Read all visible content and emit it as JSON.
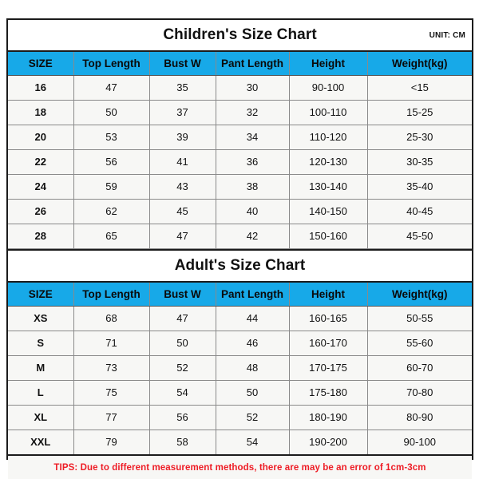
{
  "page": {
    "background_color": "#ffffff",
    "accent_color": "#17a9e8",
    "tips_color": "#ee1c25",
    "border_color": "#1b1b1b",
    "row_background": "#f7f7f5"
  },
  "children_chart": {
    "title": "Children's Size Chart",
    "unit_label": "UNIT: CM",
    "columns": [
      "SIZE",
      "Top Length",
      "Bust W",
      "Pant Length",
      "Height",
      "Weight(kg)"
    ],
    "rows": [
      [
        "16",
        "47",
        "35",
        "30",
        "90-100",
        "<15"
      ],
      [
        "18",
        "50",
        "37",
        "32",
        "100-110",
        "15-25"
      ],
      [
        "20",
        "53",
        "39",
        "34",
        "110-120",
        "25-30"
      ],
      [
        "22",
        "56",
        "41",
        "36",
        "120-130",
        "30-35"
      ],
      [
        "24",
        "59",
        "43",
        "38",
        "130-140",
        "35-40"
      ],
      [
        "26",
        "62",
        "45",
        "40",
        "140-150",
        "40-45"
      ],
      [
        "28",
        "65",
        "47",
        "42",
        "150-160",
        "45-50"
      ]
    ]
  },
  "adult_chart": {
    "title": "Adult's Size Chart",
    "columns": [
      "SIZE",
      "Top Length",
      "Bust W",
      "Pant Length",
      "Height",
      "Weight(kg)"
    ],
    "rows": [
      [
        "XS",
        "68",
        "47",
        "44",
        "160-165",
        "50-55"
      ],
      [
        "S",
        "71",
        "50",
        "46",
        "160-170",
        "55-60"
      ],
      [
        "M",
        "73",
        "52",
        "48",
        "170-175",
        "60-70"
      ],
      [
        "L",
        "75",
        "54",
        "50",
        "175-180",
        "70-80"
      ],
      [
        "XL",
        "77",
        "56",
        "52",
        "180-190",
        "80-90"
      ],
      [
        "XXL",
        "79",
        "58",
        "54",
        "190-200",
        "90-100"
      ]
    ]
  },
  "footer": {
    "tips": "TIPS: Due to different measurement methods, there are may be an error of 1cm-3cm"
  },
  "chart_data": {
    "type": "table",
    "title": "Children's and Adult's Size Charts",
    "unit": "CM",
    "tables": [
      {
        "name": "Children's Size Chart",
        "columns": [
          "SIZE",
          "Top Length",
          "Bust W",
          "Pant Length",
          "Height",
          "Weight(kg)"
        ],
        "rows": [
          [
            "16",
            "47",
            "35",
            "30",
            "90-100",
            "<15"
          ],
          [
            "18",
            "50",
            "37",
            "32",
            "100-110",
            "15-25"
          ],
          [
            "20",
            "53",
            "39",
            "34",
            "110-120",
            "25-30"
          ],
          [
            "22",
            "56",
            "41",
            "36",
            "120-130",
            "30-35"
          ],
          [
            "24",
            "59",
            "43",
            "38",
            "130-140",
            "35-40"
          ],
          [
            "26",
            "62",
            "45",
            "40",
            "140-150",
            "40-45"
          ],
          [
            "28",
            "65",
            "47",
            "42",
            "150-160",
            "45-50"
          ]
        ]
      },
      {
        "name": "Adult's Size Chart",
        "columns": [
          "SIZE",
          "Top Length",
          "Bust W",
          "Pant Length",
          "Height",
          "Weight(kg)"
        ],
        "rows": [
          [
            "XS",
            "68",
            "47",
            "44",
            "160-165",
            "50-55"
          ],
          [
            "S",
            "71",
            "50",
            "46",
            "160-170",
            "55-60"
          ],
          [
            "M",
            "73",
            "52",
            "48",
            "170-175",
            "60-70"
          ],
          [
            "L",
            "75",
            "54",
            "50",
            "175-180",
            "70-80"
          ],
          [
            "XL",
            "77",
            "56",
            "52",
            "180-190",
            "80-90"
          ],
          [
            "XXL",
            "79",
            "58",
            "54",
            "190-200",
            "90-100"
          ]
        ]
      }
    ],
    "note": "TIPS: Due to different measurement methods, there are may be an error of 1cm-3cm"
  }
}
